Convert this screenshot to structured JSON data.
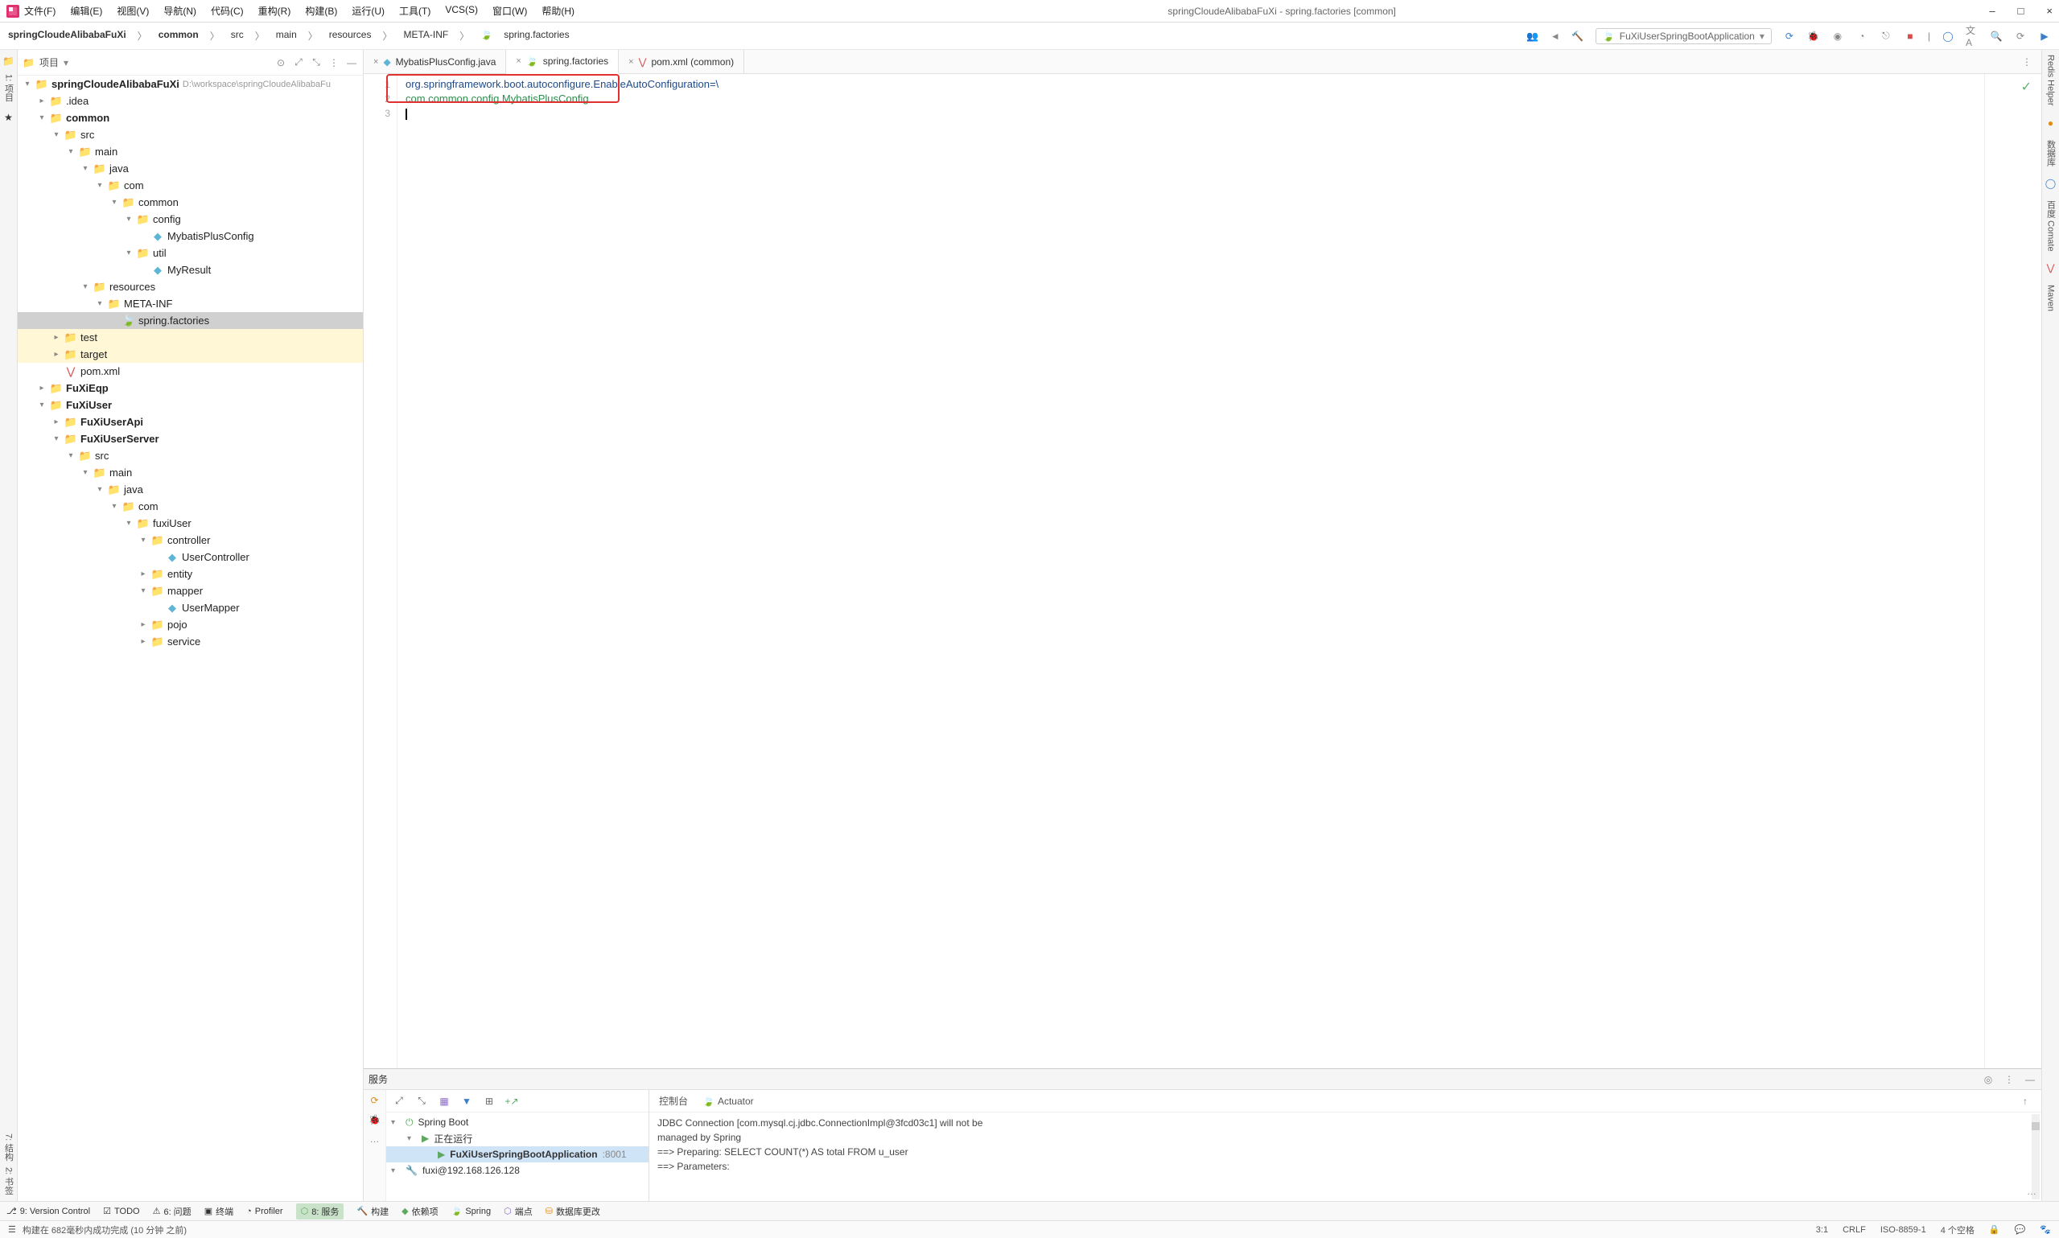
{
  "title": "springCloudeAlibabaFuXi - spring.factories [common]",
  "menubar": [
    "文件(F)",
    "编辑(E)",
    "视图(V)",
    "导航(N)",
    "代码(C)",
    "重构(R)",
    "构建(B)",
    "运行(U)",
    "工具(T)",
    "VCS(S)",
    "窗口(W)",
    "帮助(H)"
  ],
  "winbtns": {
    "min": "–",
    "max": "□",
    "close": "×"
  },
  "breadcrumb": [
    "springCloudeAlibabaFuXi",
    "common",
    "src",
    "main",
    "resources",
    "META-INF",
    "spring.factories"
  ],
  "breadcrumb_file_icon": "🍃",
  "run_combo": "FuXiUserSpringBootApplication",
  "project_dropdown": "项目",
  "project_root": {
    "name": "springCloudeAlibabaFuXi",
    "path": "D:\\workspace\\springCloudeAlibabaFu"
  },
  "tree": [
    {
      "indent": 0,
      "twisty": "▾",
      "icon": "folder-root",
      "label": "springCloudeAlibabaFuXi",
      "bold": true,
      "extra": "D:\\workspace\\springCloudeAlibabaFu"
    },
    {
      "indent": 1,
      "twisty": "▸",
      "icon": "folder-orange",
      "label": ".idea"
    },
    {
      "indent": 1,
      "twisty": "▾",
      "icon": "folder-blue",
      "label": "common",
      "bold": true
    },
    {
      "indent": 2,
      "twisty": "▾",
      "icon": "folder-blue",
      "label": "src"
    },
    {
      "indent": 3,
      "twisty": "▾",
      "icon": "folder-black",
      "label": "main"
    },
    {
      "indent": 4,
      "twisty": "▾",
      "icon": "folder-purple",
      "label": "java"
    },
    {
      "indent": 5,
      "twisty": "▾",
      "icon": "folder-yellow",
      "label": "com"
    },
    {
      "indent": 6,
      "twisty": "▾",
      "icon": "folder-cyan",
      "label": "common"
    },
    {
      "indent": 7,
      "twisty": "▾",
      "icon": "folder-cyan",
      "label": "config"
    },
    {
      "indent": 8,
      "twisty": "",
      "icon": "class",
      "label": "MybatisPlusConfig"
    },
    {
      "indent": 7,
      "twisty": "▾",
      "icon": "folder-cyan",
      "label": "util"
    },
    {
      "indent": 8,
      "twisty": "",
      "icon": "class",
      "label": "MyResult"
    },
    {
      "indent": 4,
      "twisty": "▾",
      "icon": "folder-purple",
      "label": "resources"
    },
    {
      "indent": 5,
      "twisty": "▾",
      "icon": "folder-yellow",
      "label": "META-INF"
    },
    {
      "indent": 6,
      "twisty": "",
      "icon": "factories",
      "label": "spring.factories",
      "selected": true
    },
    {
      "indent": 2,
      "twisty": "▸",
      "icon": "folder-cyan",
      "label": "test",
      "highlighted": true
    },
    {
      "indent": 2,
      "twisty": "▸",
      "icon": "folder-red",
      "label": "target",
      "highlighted": true
    },
    {
      "indent": 2,
      "twisty": "",
      "icon": "maven",
      "label": "pom.xml"
    },
    {
      "indent": 1,
      "twisty": "▸",
      "icon": "folder-blue",
      "label": "FuXiEqp",
      "bold": true
    },
    {
      "indent": 1,
      "twisty": "▾",
      "icon": "folder-blue",
      "label": "FuXiUser",
      "bold": true
    },
    {
      "indent": 2,
      "twisty": "▸",
      "icon": "folder-blue",
      "label": "FuXiUserApi",
      "bold": true
    },
    {
      "indent": 2,
      "twisty": "▾",
      "icon": "folder-blue",
      "label": "FuXiUserServer",
      "bold": true
    },
    {
      "indent": 3,
      "twisty": "▾",
      "icon": "folder-blue",
      "label": "src"
    },
    {
      "indent": 4,
      "twisty": "▾",
      "icon": "folder-black",
      "label": "main"
    },
    {
      "indent": 5,
      "twisty": "▾",
      "icon": "folder-purple",
      "label": "java"
    },
    {
      "indent": 6,
      "twisty": "▾",
      "icon": "folder-yellow",
      "label": "com"
    },
    {
      "indent": 7,
      "twisty": "▾",
      "icon": "folder-yellow",
      "label": "fuxiUser"
    },
    {
      "indent": 8,
      "twisty": "▾",
      "icon": "folder-cyan",
      "label": "controller"
    },
    {
      "indent": 9,
      "twisty": "",
      "icon": "class",
      "label": "UserController"
    },
    {
      "indent": 8,
      "twisty": "▸",
      "icon": "folder-cyan",
      "label": "entity"
    },
    {
      "indent": 8,
      "twisty": "▾",
      "icon": "folder-cyan",
      "label": "mapper"
    },
    {
      "indent": 9,
      "twisty": "",
      "icon": "class",
      "label": "UserMapper"
    },
    {
      "indent": 8,
      "twisty": "▸",
      "icon": "folder-cyan",
      "label": "pojo"
    },
    {
      "indent": 8,
      "twisty": "▸",
      "icon": "folder-cyan",
      "label": "service"
    }
  ],
  "tabs": [
    {
      "icon": "class",
      "label": "MybatisPlusConfig.java"
    },
    {
      "icon": "factories",
      "label": "spring.factories",
      "active": true
    },
    {
      "icon": "maven",
      "label": "pom.xml (common)"
    }
  ],
  "editor_lines": {
    "1": "org.springframework.boot.autoconfigure.EnableAutoConfiguration=\\",
    "2": "    com.common.config.MybatisPlusConfig",
    "3": ""
  },
  "bottom_title": "服务",
  "bottom_tree": [
    {
      "indent": 0,
      "twisty": "▾",
      "icon": "power",
      "label": "Spring Boot"
    },
    {
      "indent": 1,
      "twisty": "▾",
      "icon": "play",
      "label": "正在运行"
    },
    {
      "indent": 2,
      "twisty": "",
      "icon": "play",
      "label": "FuXiUserSpringBootApplication",
      "suffix": ":8001",
      "selected": true,
      "bold": true
    },
    {
      "indent": 0,
      "twisty": "▾",
      "icon": "wrench",
      "label": "fuxi@192.168.126.128"
    }
  ],
  "console_tabs": [
    "控制台",
    "Actuator"
  ],
  "console_lines": [
    "JDBC Connection [com.mysql.cj.jdbc.ConnectionImpl@3fcd03c1] will not be",
    " managed by Spring",
    "==>  Preparing: SELECT COUNT(*) AS total FROM u_user",
    "==> Parameters:"
  ],
  "bottombar": [
    {
      "icon": "git",
      "label": "9: Version Control"
    },
    {
      "icon": "todo",
      "label": "TODO"
    },
    {
      "icon": "problem",
      "label": "6: 问题"
    },
    {
      "icon": "terminal",
      "label": "终端"
    },
    {
      "icon": "profiler",
      "label": "Profiler"
    },
    {
      "icon": "services",
      "label": "8: 服务",
      "active": true
    },
    {
      "icon": "build",
      "label": "构建"
    },
    {
      "icon": "deps",
      "label": "依赖项"
    },
    {
      "icon": "spring",
      "label": "Spring"
    },
    {
      "icon": "endpoint",
      "label": "端点"
    },
    {
      "icon": "db",
      "label": "数据库更改"
    }
  ],
  "status_left": {
    "icon": "☰",
    "text": "构建在 682毫秒内成功完成 (10 分钟 之前)"
  },
  "status_right": [
    "3:1",
    "CRLF",
    "ISO-8859-1",
    "4 个空格"
  ],
  "leftstrip": [
    "1: 项目"
  ],
  "leftstrip_bottom": [
    "7: 结构",
    "2: 书签"
  ],
  "rightstrip": [
    "Redis Helper",
    "数据库",
    "百度 Comate",
    "Maven"
  ]
}
